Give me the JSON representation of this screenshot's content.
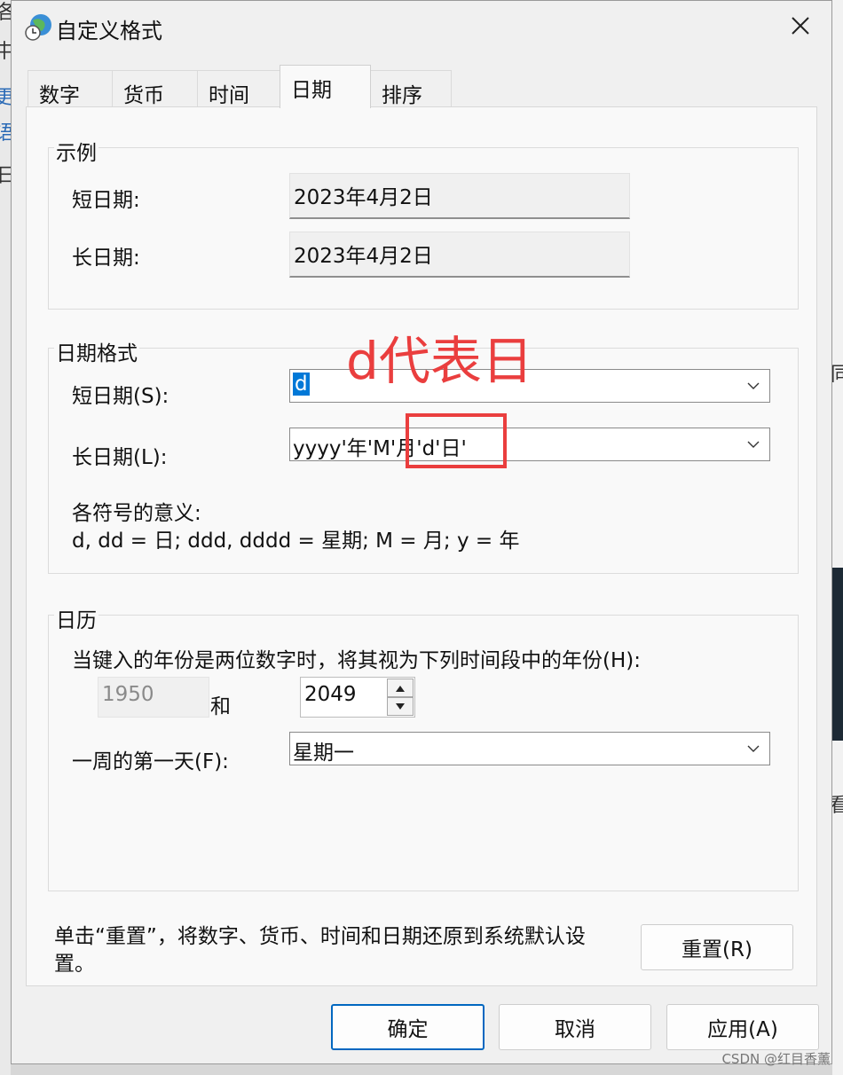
{
  "window": {
    "title": "自定义格式"
  },
  "tabs": [
    {
      "label": "数字"
    },
    {
      "label": "货币"
    },
    {
      "label": "时间"
    },
    {
      "label": "日期",
      "active": true
    },
    {
      "label": "排序"
    }
  ],
  "example": {
    "group_title": "示例",
    "short_label": "短日期:",
    "short_value": "2023年4月2日",
    "long_label": "长日期:",
    "long_value": "2023年4月2日"
  },
  "date_format": {
    "group_title": "日期格式",
    "short_label": "短日期(S):",
    "short_value": "d",
    "long_label": "长日期(L):",
    "long_value": "yyyy'年'M'月'd'日'",
    "legend_title": "各符号的意义:",
    "legend_text": "d, dd = 日;  ddd, dddd = 星期;  M = 月;  y = 年"
  },
  "annotation": {
    "text": "d代表日",
    "color": "#ea3e3e"
  },
  "calendar": {
    "group_title": "日历",
    "two_digit_label": "当键入的年份是两位数字时，将其视为下列时间段中的年份(H):",
    "year_from": "1950",
    "and_label": "和",
    "year_to": "2049",
    "first_day_label": "一周的第一天(F):",
    "first_day_value": "星期一"
  },
  "reset": {
    "description": "单击“重置”，将数字、货币、时间和日期还原到系统默认设置。",
    "button_label": "重置(R)"
  },
  "footer": {
    "ok": "确定",
    "cancel": "取消",
    "apply": "应用(A)"
  },
  "background": {
    "left_glyphs": [
      "各",
      "中",
      "更",
      "语",
      "日"
    ],
    "right_glyphs": [
      "同",
      "看"
    ]
  },
  "watermark": "CSDN @红目香薰",
  "colors": {
    "accent": "#0078d7",
    "annotation": "#ea3e3e"
  }
}
